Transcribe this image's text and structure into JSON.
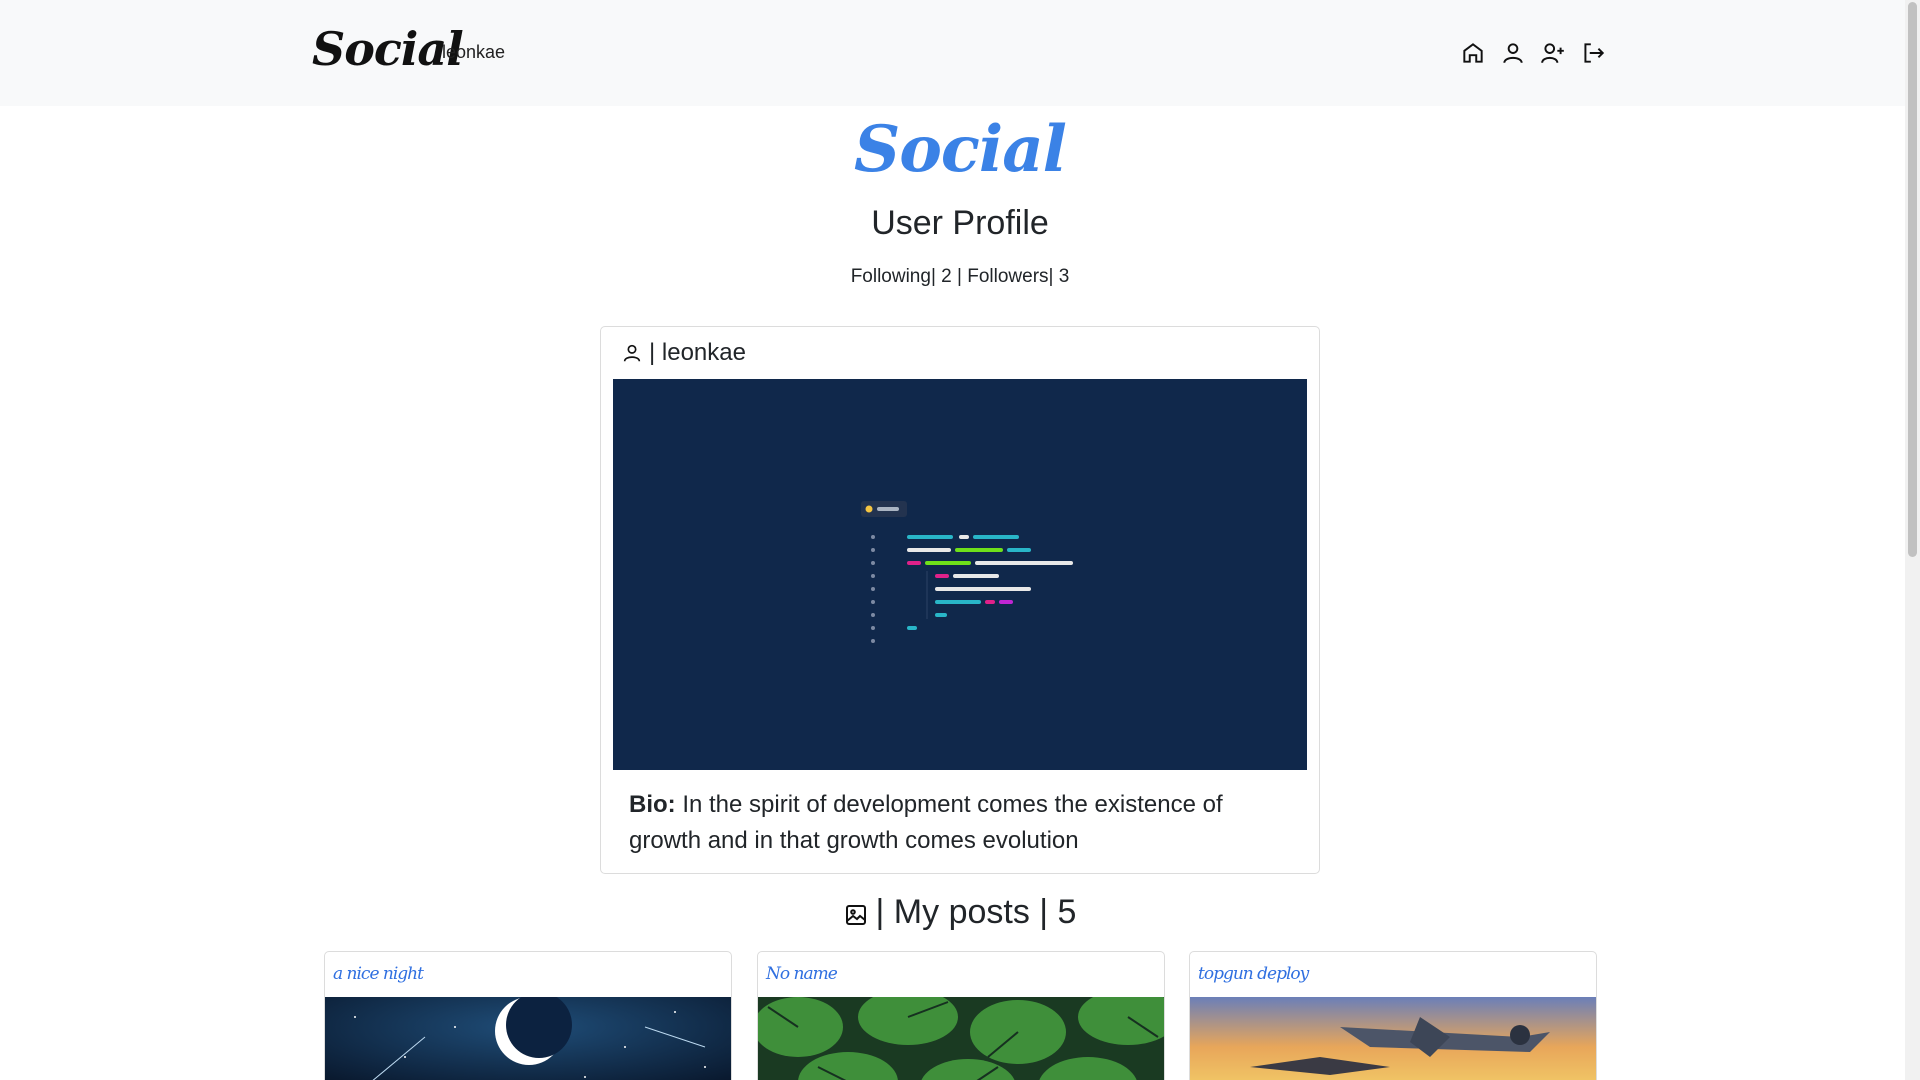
{
  "nav": {
    "brand": "Social",
    "username": "leonkae",
    "icons": [
      "home-icon",
      "person-icon",
      "person-plus-icon",
      "logout-icon"
    ]
  },
  "hero": {
    "logo": "Social",
    "title": "User Profile",
    "stats": "Following| 2 | Followers| 3"
  },
  "profile": {
    "separator_username": "| leonkae",
    "bio_label": "Bio:",
    "bio_text": " In the spirit of development comes the existence of growth and in that growth comes evolution"
  },
  "posts": {
    "heading": "| My posts | 5",
    "items": [
      {
        "title": "a nice night"
      },
      {
        "title": "No name"
      },
      {
        "title": "topgun deploy"
      }
    ]
  },
  "colors": {
    "accent": "#3b82e6",
    "navbar_bg": "#f8f9fa",
    "profile_image_bg": "#10284b"
  }
}
